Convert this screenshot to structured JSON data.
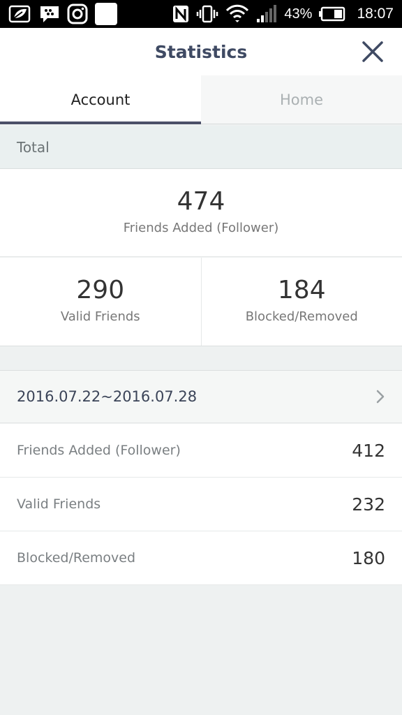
{
  "status_bar": {
    "battery_percent": "43%",
    "time": "18:07",
    "left_icons": [
      "leaf-notification-icon",
      "chat-bubble-icon",
      "instagram-icon",
      "blank-app-icon"
    ],
    "right_icons": [
      "nfc-icon",
      "vibrate-icon",
      "wifi-icon",
      "signal-icon",
      "battery-icon"
    ]
  },
  "header": {
    "title": "Statistics",
    "close_icon": "close-icon"
  },
  "tabs": [
    {
      "label": "Account",
      "active": true
    },
    {
      "label": "Home",
      "active": false
    }
  ],
  "total": {
    "section_label": "Total",
    "friends_added": {
      "value": "474",
      "label": "Friends Added (Follower)"
    },
    "valid_friends": {
      "value": "290",
      "label": "Valid Friends"
    },
    "blocked_removed": {
      "value": "184",
      "label": "Blocked/Removed"
    }
  },
  "range": {
    "dates": "2016.07.22~2016.07.28",
    "rows": [
      {
        "label": "Friends Added (Follower)",
        "value": "412"
      },
      {
        "label": "Valid Friends",
        "value": "232"
      },
      {
        "label": "Blocked/Removed",
        "value": "180"
      }
    ]
  },
  "colors": {
    "header_title": "#3f4a63",
    "tab_indicator": "#4b5068",
    "page_background": "#eef1f1"
  }
}
